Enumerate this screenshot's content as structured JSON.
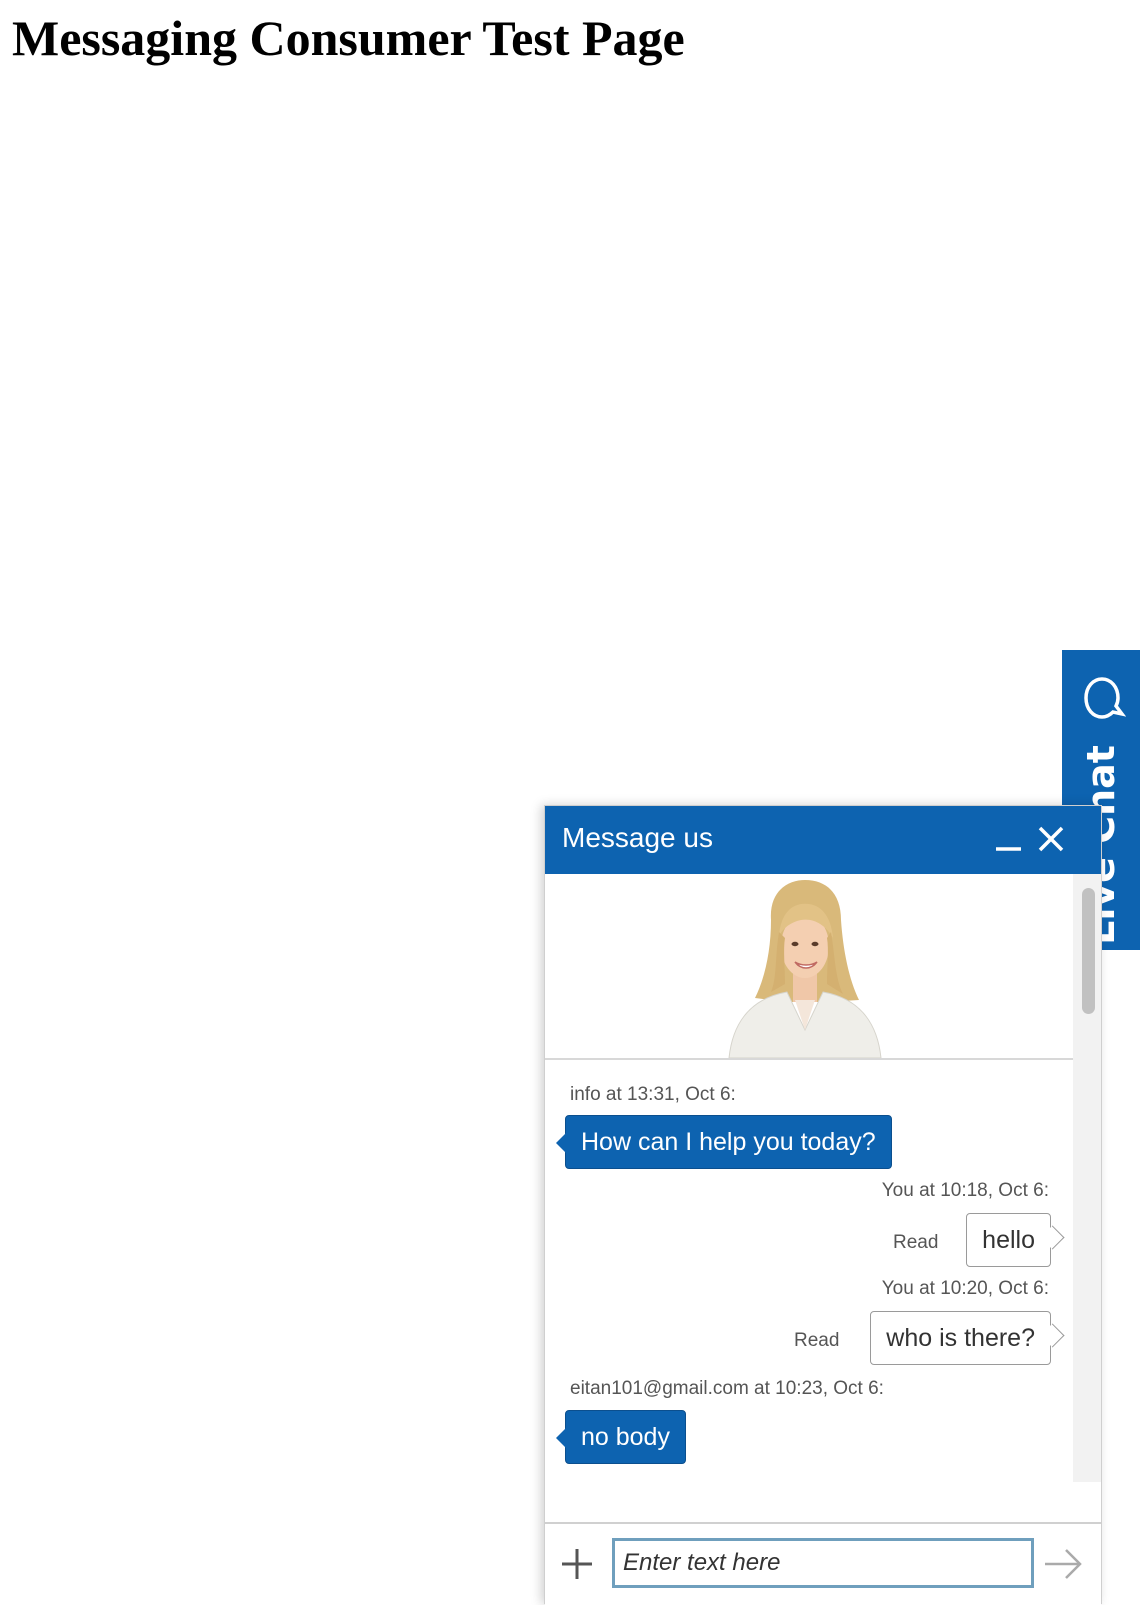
{
  "page": {
    "title": "Messaging Consumer Test Page"
  },
  "live_tab": {
    "label": "Live Chat",
    "icon": "chat-bubble-icon"
  },
  "chat": {
    "title": "Message us",
    "minimize_icon": "minimize-icon",
    "close_icon": "close-icon",
    "messages": [
      {
        "sender": "agent",
        "meta": "info at 13:31, Oct 6:",
        "text": "How can I help you today?"
      },
      {
        "sender": "visitor",
        "meta": "You at 10:18, Oct 6:",
        "text": "hello",
        "status": "Read"
      },
      {
        "sender": "visitor",
        "meta": "You at 10:20, Oct 6:",
        "text": "who is there?",
        "status": "Read"
      },
      {
        "sender": "agent",
        "meta": "eitan101@gmail.com at 10:23, Oct 6:",
        "text": "no body"
      }
    ],
    "composer": {
      "placeholder": "Enter text here",
      "value": "",
      "attach_icon": "plus-icon",
      "send_icon": "send-arrow-icon"
    }
  },
  "colors": {
    "brand": "#0d63b0",
    "input_border": "#6f9fbd"
  }
}
